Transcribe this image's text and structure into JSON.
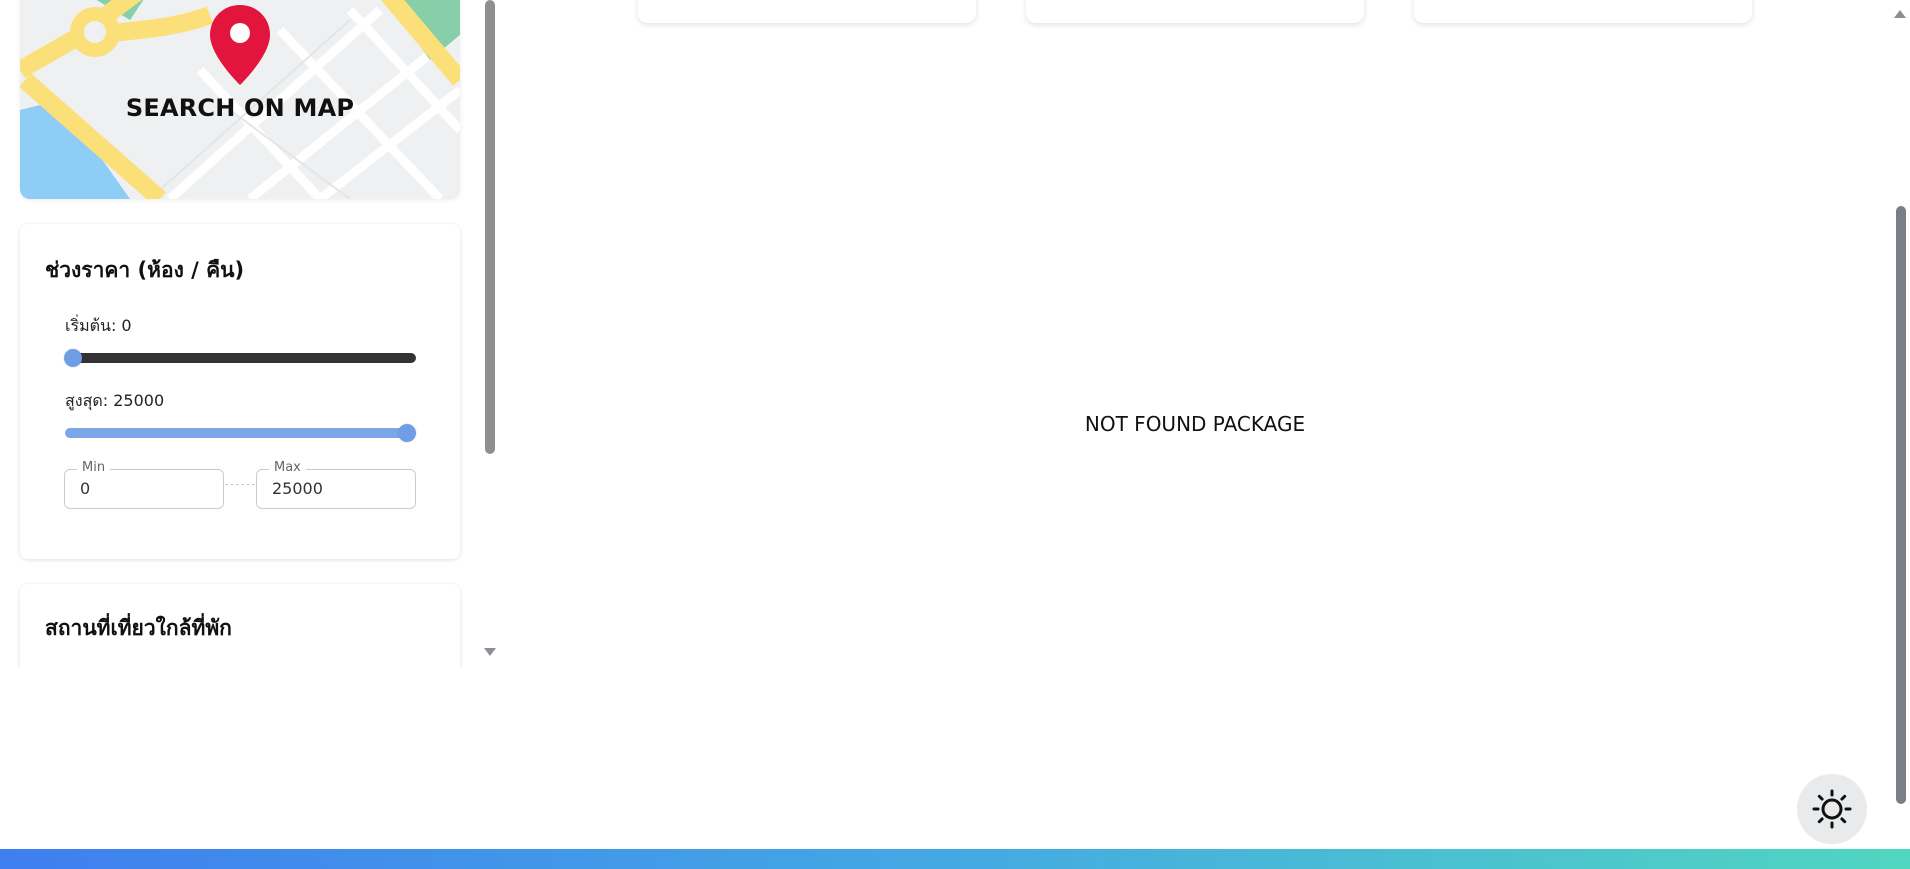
{
  "sidebar": {
    "map_card": {
      "label": "SEARCH ON MAP",
      "icon": "map-pin-icon"
    },
    "price_range": {
      "title": "ช่วงราคา (ห้อง / คืน)",
      "min_slider": {
        "label": "เริ่มต้น:",
        "value": "0"
      },
      "max_slider": {
        "label": "สูงสุด:",
        "value": "25000"
      },
      "min_field": {
        "legend": "Min",
        "value": "0"
      },
      "max_field": {
        "legend": "Max",
        "value": "25000"
      }
    },
    "nearby_places": {
      "title": "สถานที่เที่ยวใกล้ที่พัก"
    }
  },
  "main": {
    "empty_message": "NOT FOUND PACKAGE"
  },
  "theme_toggle": {
    "icon": "sun-icon"
  },
  "colors": {
    "accent": "#6f9ee6",
    "pin": "#e2163d",
    "footer_gradient_start": "#3f7ef0",
    "footer_gradient_end": "#50d6c0"
  }
}
